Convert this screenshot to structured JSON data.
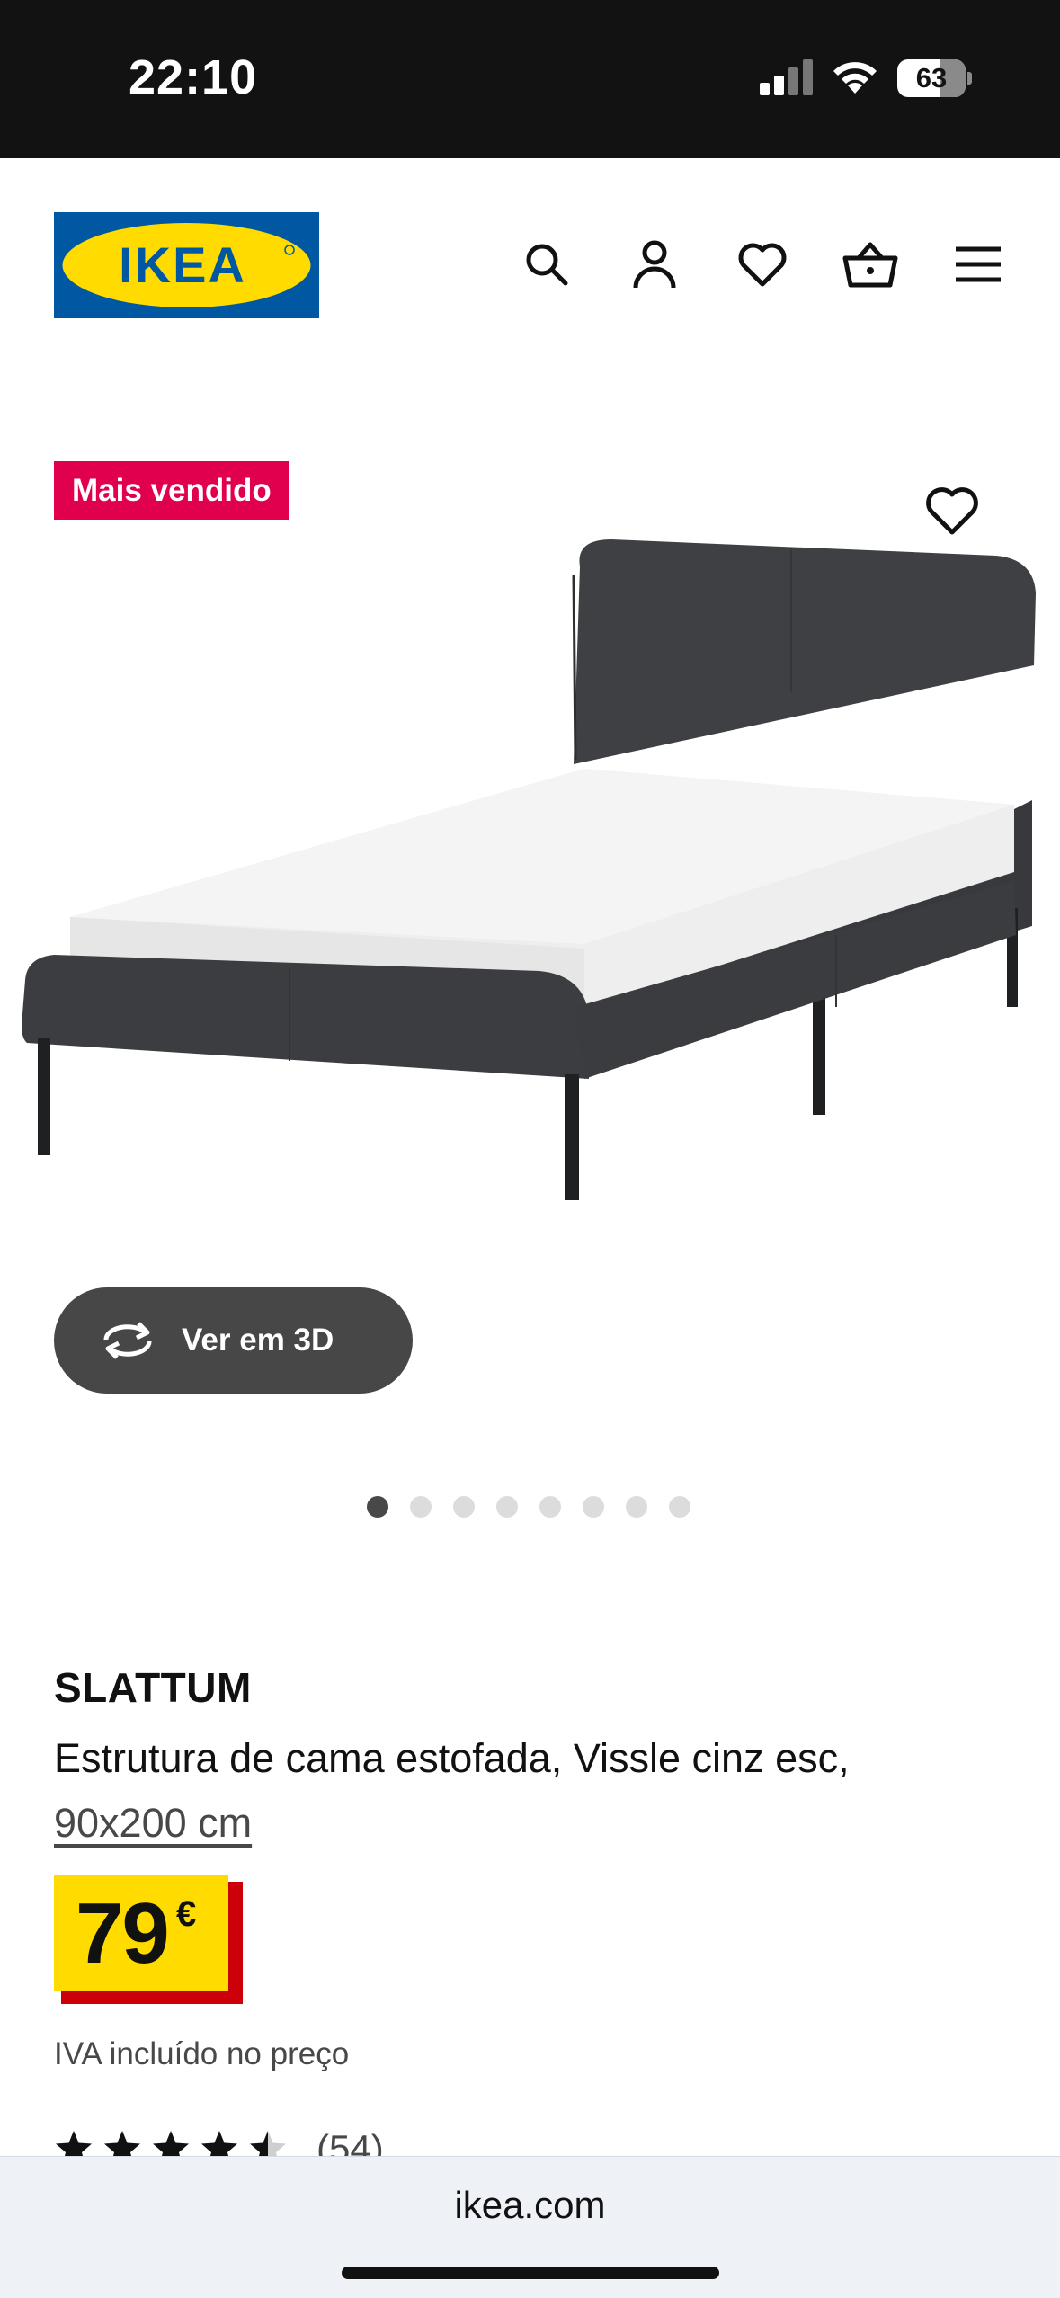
{
  "status_bar": {
    "time": "22:10",
    "battery": "63",
    "battery_level_percent": 63
  },
  "header": {
    "logo_text": "IKEA",
    "icons": [
      "search-icon",
      "account-icon",
      "wishlist-icon",
      "cart-icon",
      "menu-icon"
    ]
  },
  "product": {
    "badge": "Mais vendido",
    "view_3d_label": "Ver em 3D",
    "image_count": 8,
    "active_image_index": 0,
    "name": "SLATTUM",
    "description": "Estrutura de cama estofada, Vissle cinz esc,",
    "size": "90x200 cm",
    "price": "79",
    "currency": "€",
    "vat_note": "IVA incluído no preço",
    "rating_value": 4.5,
    "rating_count": "(54)"
  },
  "browser": {
    "url": "ikea.com"
  },
  "colors": {
    "status_bar_bg": "#121212",
    "ikea_blue": "#0058a3",
    "ikea_yellow": "#ffdb00",
    "badge_red": "#e0004d",
    "price_shadow_red": "#cc0008",
    "bed_fabric": "#3c3e41",
    "view3d_bg": "#474747"
  }
}
